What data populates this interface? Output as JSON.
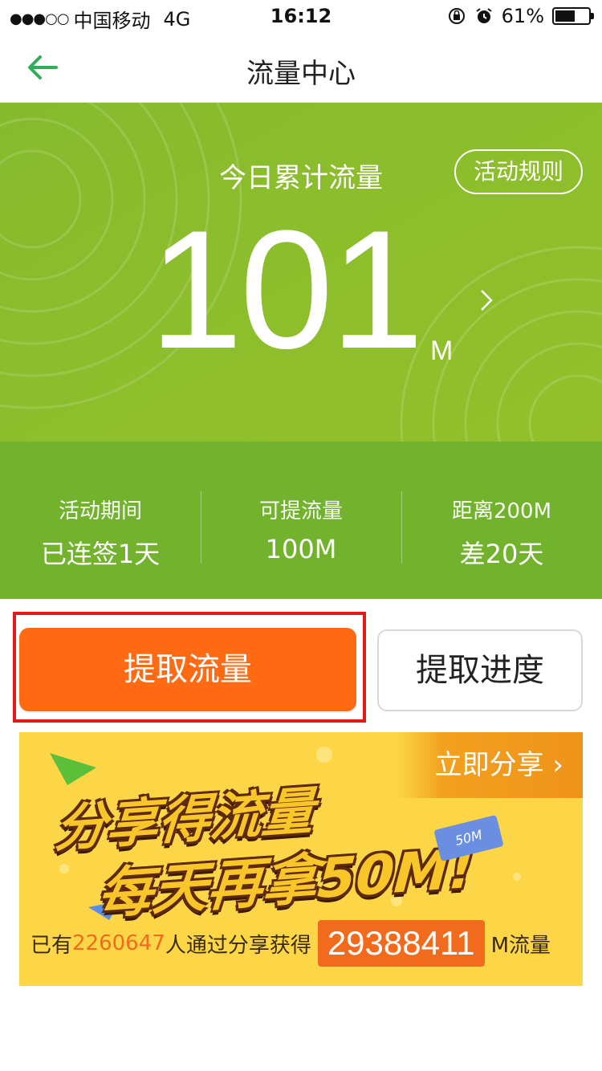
{
  "status_bar": {
    "carrier": "中国移动",
    "network": "4G",
    "time": "16:12",
    "battery": "61%",
    "battery_level": 0.61
  },
  "nav": {
    "title": "流量中心"
  },
  "hero": {
    "label": "今日累计流量",
    "rules_button": "活动规则",
    "value": "101",
    "unit": "M"
  },
  "stats": [
    {
      "label": "活动期间",
      "value": "已连签1天"
    },
    {
      "label": "可提流量",
      "value": "100M"
    },
    {
      "label": "距离200M",
      "value": "差20天"
    }
  ],
  "actions": {
    "extract": "提取流量",
    "progress": "提取进度"
  },
  "banner": {
    "share_now": "立即分享",
    "slogan_line1": "分享得流量",
    "slogan_line2": "每天再拿50M!",
    "badge": "50M",
    "prefix": "已有",
    "user_count": "2260647",
    "middle": "人通过分享获得",
    "total": "29388411",
    "suffix": "M流量"
  },
  "colors": {
    "hero_green": "#8bbd2c",
    "stats_green": "#72b22d",
    "primary_orange": "#ff6a12",
    "highlight_red": "#e21a1a",
    "banner_yellow": "#fcd647"
  }
}
